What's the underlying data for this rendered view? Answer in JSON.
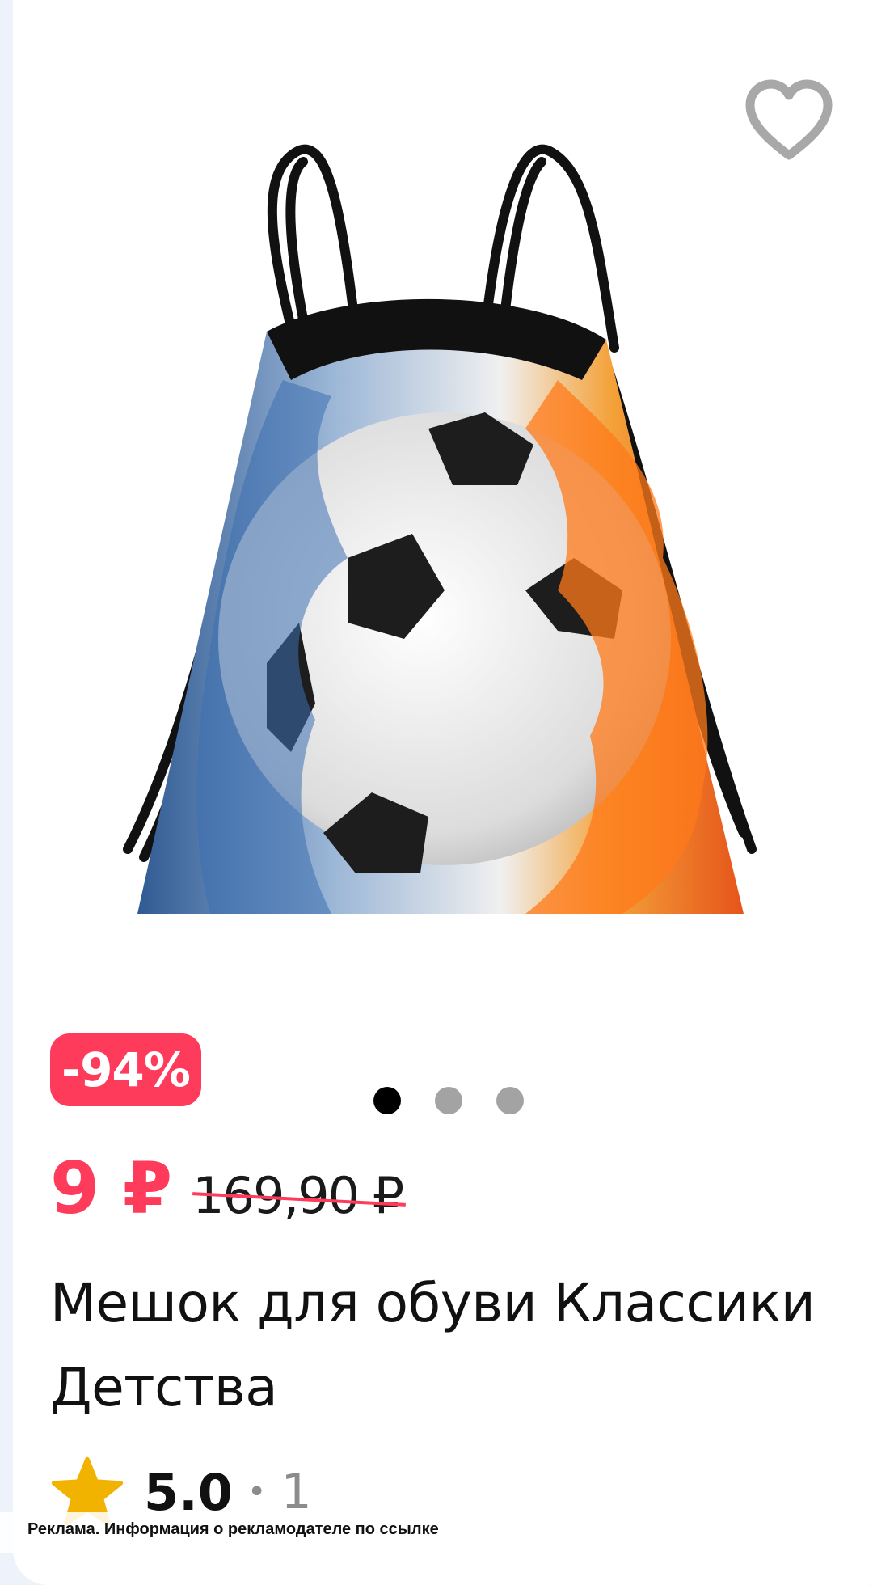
{
  "product": {
    "image_alt": "Мешок для обуви с футбольным мячом",
    "favorite_icon": "heart-outline-icon",
    "discount_badge": "-94%",
    "carousel": {
      "total": 3,
      "active_index": 0
    },
    "price_current": "9 ₽",
    "price_old": "169,90 ₽",
    "title": "Мешок для обуви Классики Детства",
    "rating": {
      "icon": "star-icon",
      "value": "5.0",
      "separator": "•",
      "count": "1"
    }
  },
  "ad_disclaimer": "Реклама. Информация о рекламодателе по ссылке",
  "colors": {
    "accent": "#ff3b5c",
    "star": "#f2b300",
    "text_primary": "#111111",
    "text_secondary": "#8c8c8c",
    "background": "#eef3fb"
  }
}
